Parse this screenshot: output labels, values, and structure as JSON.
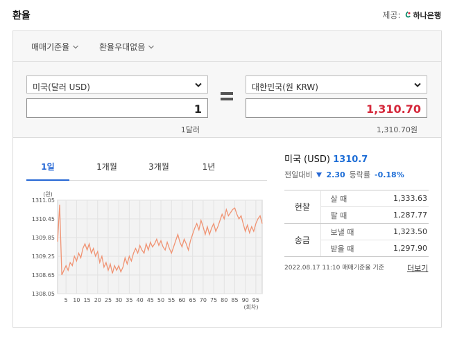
{
  "header": {
    "title": "환율",
    "provider_label": "제공:",
    "provider_name": "하나은행"
  },
  "options": {
    "rate_type": "매매기준율",
    "preferential": "환율우대없음"
  },
  "converter": {
    "from_currency": "미국(달러 USD)",
    "from_amount": "1",
    "from_caption": "1달러",
    "to_currency": "대한민국(원 KRW)",
    "to_amount": "1,310.70",
    "to_caption": "1,310.70원"
  },
  "tabs": [
    "1일",
    "1개월",
    "3개월",
    "1년"
  ],
  "summary": {
    "country": "미국 (USD)",
    "rate": "1310.7",
    "prev_label": "전일대비",
    "prev_change": "2.30",
    "pct_label": "등락률",
    "pct_change": "-0.18%"
  },
  "rates_table": {
    "cash_label": "현찰",
    "remit_label": "송금",
    "rows": [
      {
        "label": "살 때",
        "value": "1,333.63"
      },
      {
        "label": "팔 때",
        "value": "1,287.77"
      },
      {
        "label": "보낼 때",
        "value": "1,323.50"
      },
      {
        "label": "받을 때",
        "value": "1,297.90"
      }
    ]
  },
  "footer": {
    "basis": "2022.08.17 11:10  매매기준율 기준",
    "more": "더보기"
  },
  "colors": {
    "accent_blue": "#1d6dd6",
    "tab_blue": "#2466d4",
    "amount_red": "#d5283b",
    "line_orange": "#f09373",
    "drop_blue": "#2466d4"
  },
  "chart_data": {
    "type": "line",
    "ylabel": "(원)",
    "xlabel": "(회차)",
    "ylim": [
      1308.05,
      1311.05
    ],
    "yticks": [
      "1311.05",
      "1310.45",
      "1309.85",
      "1309.25",
      "1308.65",
      "1308.05"
    ],
    "xticks": [
      "5",
      "10",
      "15",
      "20",
      "25",
      "30",
      "35",
      "40",
      "45",
      "50",
      "55",
      "60",
      "65",
      "70",
      "75",
      "80",
      "85",
      "90",
      "95"
    ],
    "x": [
      1,
      2,
      3,
      4,
      5,
      6,
      7,
      8,
      9,
      10,
      11,
      12,
      13,
      14,
      15,
      16,
      17,
      18,
      19,
      20,
      21,
      22,
      23,
      24,
      25,
      26,
      27,
      28,
      29,
      30,
      31,
      32,
      33,
      34,
      35,
      36,
      37,
      38,
      39,
      40,
      41,
      42,
      43,
      44,
      45,
      46,
      47,
      48,
      49,
      50,
      51,
      52,
      53,
      54,
      55,
      56,
      57,
      58,
      59,
      60,
      61,
      62,
      63,
      64,
      65,
      66,
      67,
      68,
      69,
      70,
      71,
      72,
      73,
      74,
      75,
      76,
      77,
      78,
      79,
      80,
      81,
      82,
      83,
      84,
      85,
      86,
      87,
      88,
      89,
      90,
      91,
      92,
      93,
      94,
      95,
      96,
      97,
      98
    ],
    "values": [
      1309.72,
      1310.9,
      1308.65,
      1308.8,
      1308.95,
      1308.8,
      1309.05,
      1308.95,
      1309.25,
      1309.1,
      1309.35,
      1309.2,
      1309.5,
      1309.65,
      1309.45,
      1309.65,
      1309.35,
      1309.5,
      1309.25,
      1309.4,
      1309.05,
      1309.25,
      1308.9,
      1309.05,
      1308.8,
      1309.0,
      1308.7,
      1308.95,
      1308.8,
      1308.95,
      1308.75,
      1308.9,
      1309.2,
      1309.0,
      1309.25,
      1309.1,
      1309.35,
      1309.5,
      1309.35,
      1309.6,
      1309.45,
      1309.35,
      1309.65,
      1309.45,
      1309.7,
      1309.55,
      1309.65,
      1309.8,
      1309.6,
      1309.75,
      1309.55,
      1309.45,
      1309.7,
      1309.5,
      1309.35,
      1309.55,
      1309.75,
      1309.95,
      1309.7,
      1309.55,
      1309.8,
      1309.65,
      1309.45,
      1309.75,
      1309.95,
      1310.15,
      1310.3,
      1310.1,
      1310.4,
      1310.2,
      1309.95,
      1310.2,
      1309.95,
      1310.15,
      1310.3,
      1310.05,
      1310.2,
      1310.4,
      1310.6,
      1310.45,
      1310.75,
      1310.55,
      1310.65,
      1310.75,
      1310.8,
      1310.6,
      1310.45,
      1310.55,
      1310.3,
      1310.05,
      1310.25,
      1310.0,
      1310.2,
      1310.05,
      1310.3,
      1310.45,
      1310.55,
      1310.3
    ]
  }
}
